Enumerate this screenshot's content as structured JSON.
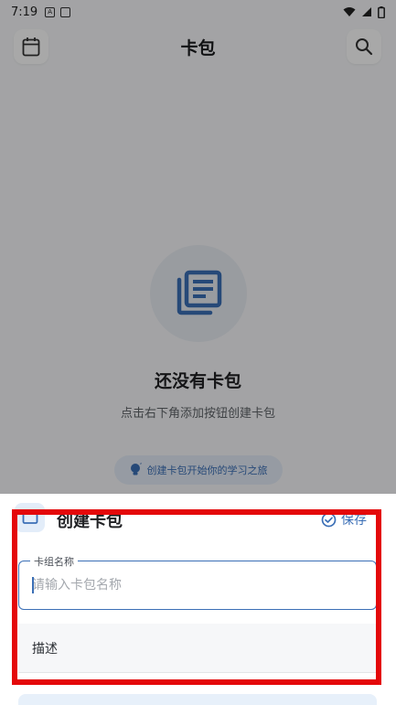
{
  "status_bar": {
    "time": "7:19"
  },
  "app_bar": {
    "title": "卡包"
  },
  "empty_state": {
    "title": "还没有卡包",
    "subtitle": "点击右下角添加按钮创建卡包",
    "tip": "创建卡包开始你的学习之旅"
  },
  "sheet": {
    "title": "创建卡包",
    "save_label": "保存",
    "name_field": {
      "label": "卡组名称",
      "placeholder": "请输入卡包名称",
      "value": ""
    },
    "description_label": "描述"
  },
  "colors": {
    "accent": "#3b6fb6",
    "highlight": "#e4080a",
    "scrim": "rgba(0,0,0,0.34)"
  },
  "icons": {
    "calendar": "calendar-icon",
    "search": "search-icon",
    "cards_stack": "cards-stack-icon",
    "lightbulb": "lightbulb-icon",
    "check_circle": "check-circle-icon"
  }
}
